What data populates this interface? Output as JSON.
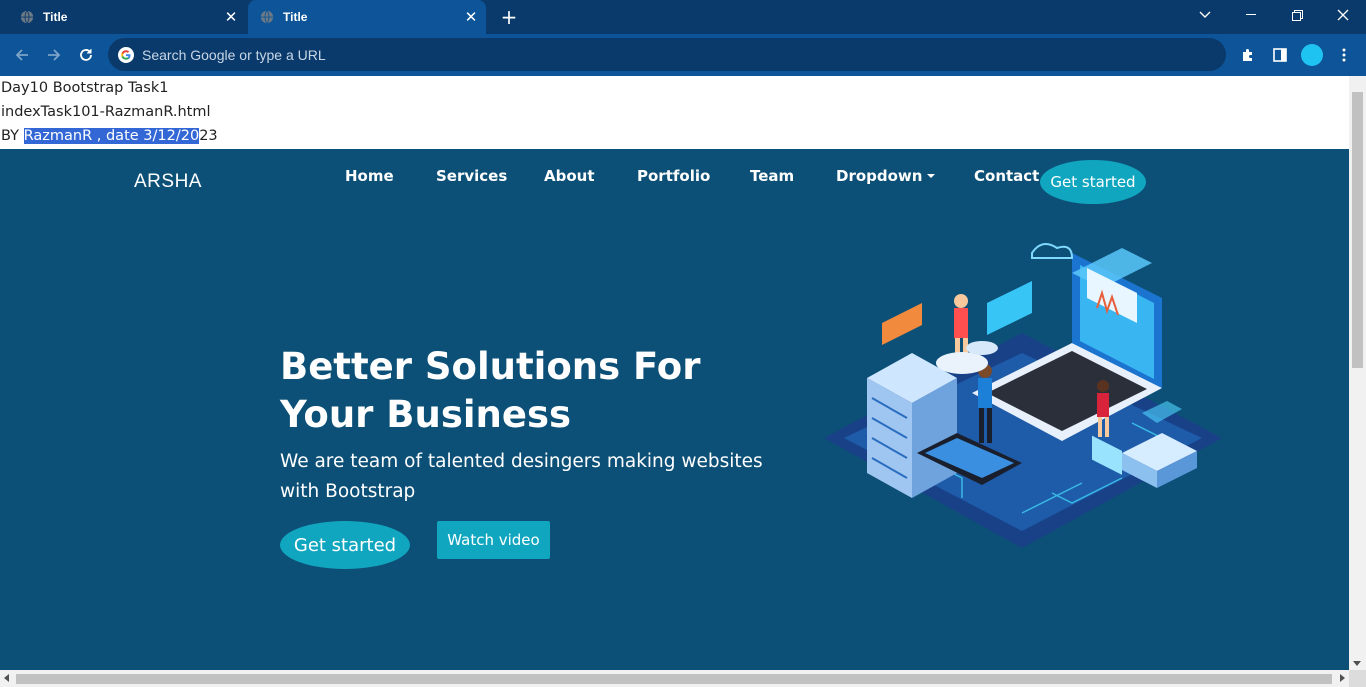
{
  "browser": {
    "tabs": [
      {
        "label": "Title",
        "active": false
      },
      {
        "label": "Title",
        "active": true
      }
    ],
    "omnibox_placeholder": "Search Google or type a URL",
    "profile_color": "#1ec3f2"
  },
  "page": {
    "info_lines": {
      "line1": "Day10 Bootstrap Task1",
      "line2": "indexTask101-RazmanR.html",
      "line3_prefix": "BY ",
      "line3_selected": "RazmanR , date 3/12/20",
      "line3_suffix": "23"
    },
    "brand": "ARSHA",
    "nav": {
      "items": [
        "Home",
        "Services",
        "About",
        "Portfolio",
        "Team",
        "Dropdown",
        "Contact"
      ],
      "cta": "Get started"
    },
    "hero": {
      "title": "Better Solutions For Your Business",
      "subtitle": "We are team of talented desingers making websites with Bootstrap",
      "primary_button": "Get started",
      "secondary_button": "Watch video"
    },
    "colors": {
      "hero_bg": "#0d5077",
      "accent": "#10a6bf",
      "chrome_dark": "#0a3a6b",
      "chrome_light": "#0d5598"
    }
  }
}
